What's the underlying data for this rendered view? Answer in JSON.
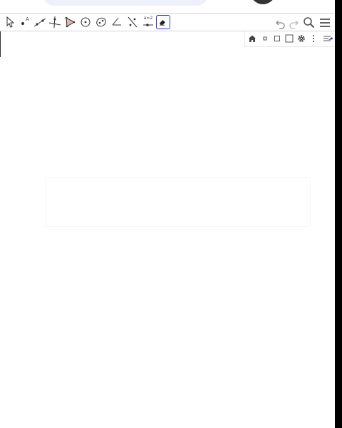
{
  "toolbar": {
    "tools": [
      {
        "id": "move",
        "icon": "move-arrow-icon"
      },
      {
        "id": "point",
        "icon": "point-icon",
        "label": "A"
      },
      {
        "id": "line",
        "icon": "line-icon"
      },
      {
        "id": "perpendicular",
        "icon": "perpendicular-line-icon"
      },
      {
        "id": "polygon",
        "icon": "polygon-icon"
      },
      {
        "id": "circle",
        "icon": "circle-center-point-icon"
      },
      {
        "id": "ellipse",
        "icon": "ellipse-icon"
      },
      {
        "id": "angle",
        "icon": "angle-icon"
      },
      {
        "id": "reflect",
        "icon": "reflect-line-icon"
      },
      {
        "id": "slider",
        "icon": "slider-icon",
        "label": "a=2"
      },
      {
        "id": "eraser",
        "icon": "eraser-icon",
        "active": true
      }
    ],
    "actions": [
      {
        "id": "undo",
        "icon": "undo-icon"
      },
      {
        "id": "redo",
        "icon": "redo-icon"
      },
      {
        "id": "search",
        "icon": "search-icon"
      },
      {
        "id": "menu",
        "icon": "hamburger-menu-icon"
      }
    ]
  },
  "graphics_style_bar": {
    "buttons": [
      {
        "id": "home",
        "icon": "home-icon"
      },
      {
        "id": "shrink",
        "icon": "small-square-icon"
      },
      {
        "id": "square",
        "icon": "square-icon"
      },
      {
        "id": "fullscreen",
        "icon": "large-square-icon"
      },
      {
        "id": "settings",
        "icon": "gear-icon"
      },
      {
        "id": "more",
        "icon": "more-vertical-icon"
      },
      {
        "id": "style-bar-toggle",
        "icon": "style-bar-toggle-icon"
      }
    ]
  },
  "colors": {
    "accent": "#2a37c7",
    "tool_point": "#444444",
    "polygon_fill": "#d27b6a",
    "background": "#ffffff"
  }
}
